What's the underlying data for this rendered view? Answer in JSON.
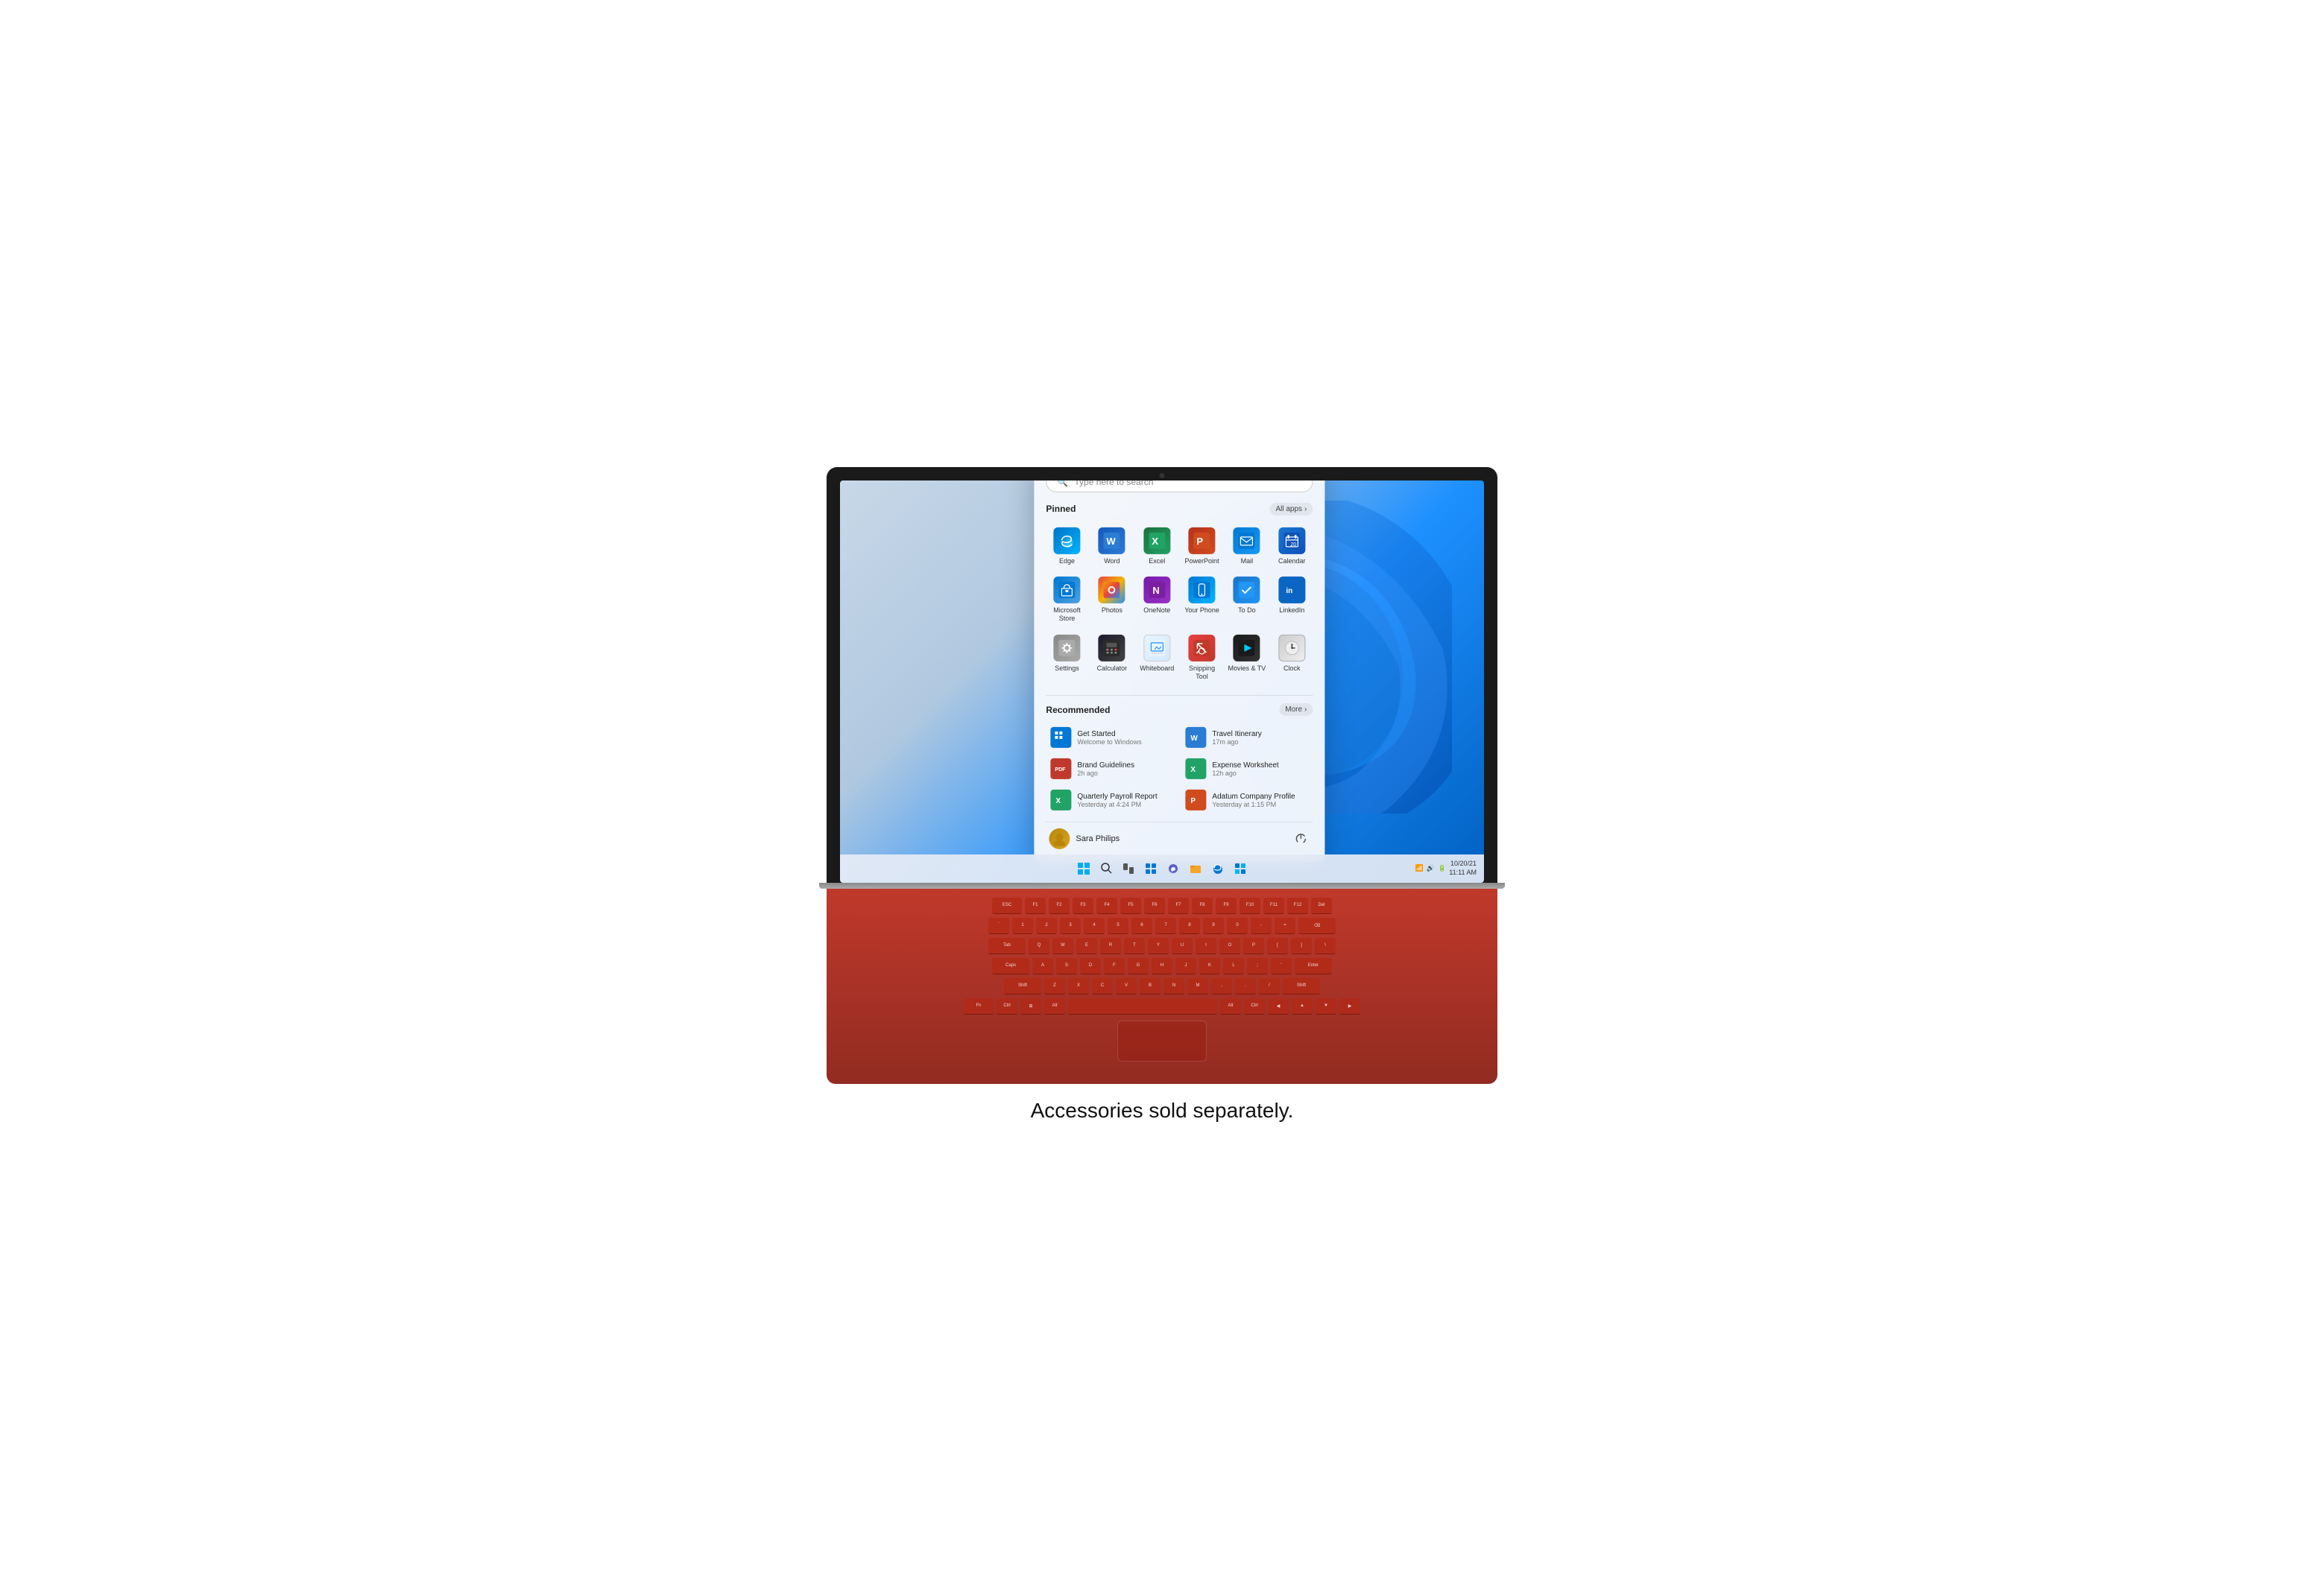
{
  "caption": "Accessories sold separately.",
  "screen": {
    "taskbar": {
      "time": "10/20/21",
      "clock": "11:11 AM"
    }
  },
  "startMenu": {
    "search": {
      "placeholder": "Type here to search"
    },
    "pinned": {
      "title": "Pinned",
      "allApps": "All apps",
      "apps": [
        {
          "id": "edge",
          "label": "Edge",
          "icon": "🌐"
        },
        {
          "id": "word",
          "label": "Word",
          "icon": "W"
        },
        {
          "id": "excel",
          "label": "Excel",
          "icon": "X"
        },
        {
          "id": "powerpoint",
          "label": "PowerPoint",
          "icon": "P"
        },
        {
          "id": "mail",
          "label": "Mail",
          "icon": "✉"
        },
        {
          "id": "calendar",
          "label": "Calendar",
          "icon": "📅"
        },
        {
          "id": "msstore",
          "label": "Microsoft Store",
          "icon": "🏪"
        },
        {
          "id": "photos",
          "label": "Photos",
          "icon": "🖼"
        },
        {
          "id": "onenote",
          "label": "OneNote",
          "icon": "N"
        },
        {
          "id": "yourphone",
          "label": "Your Phone",
          "icon": "📱"
        },
        {
          "id": "todo",
          "label": "To Do",
          "icon": "✔"
        },
        {
          "id": "linkedin",
          "label": "LinkedIn",
          "icon": "in"
        },
        {
          "id": "settings",
          "label": "Settings",
          "icon": "⚙"
        },
        {
          "id": "calculator",
          "label": "Calculator",
          "icon": "#"
        },
        {
          "id": "whiteboard",
          "label": "Whiteboard",
          "icon": "🖊"
        },
        {
          "id": "snipping",
          "label": "Snipping Tool",
          "icon": "✂"
        },
        {
          "id": "movies",
          "label": "Movies & TV",
          "icon": "▶"
        },
        {
          "id": "clock",
          "label": "Clock",
          "icon": "🕐"
        }
      ]
    },
    "recommended": {
      "title": "Recommended",
      "moreBtn": "More",
      "items": [
        {
          "id": "getstarted",
          "title": "Get Started",
          "sub": "Welcome to Windows",
          "icon": "🪟"
        },
        {
          "id": "travelitinerary",
          "title": "Travel Itinerary",
          "sub": "17m ago",
          "icon": "W"
        },
        {
          "id": "brandguidelines",
          "title": "Brand Guidelines",
          "sub": "2h ago",
          "icon": "PDF"
        },
        {
          "id": "expenseworksheet",
          "title": "Expense Worksheet",
          "sub": "12h ago",
          "icon": "X"
        },
        {
          "id": "payrollreport",
          "title": "Quarterly Payroll Report",
          "sub": "Yesterday at 4:24 PM",
          "icon": "X"
        },
        {
          "id": "adatumprofile",
          "title": "Adatum Company Profile",
          "sub": "Yesterday at 1:15 PM",
          "icon": "P"
        }
      ]
    },
    "user": {
      "name": "Sara Philips",
      "avatar": "👤"
    }
  }
}
